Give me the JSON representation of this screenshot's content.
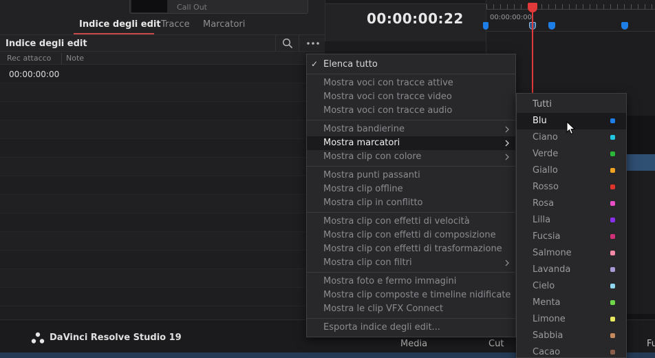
{
  "clip_card": {
    "name": "Call Out"
  },
  "panel": {
    "tabs": [
      {
        "label": "Indice degli edit",
        "active": true
      },
      {
        "label": "Tracce",
        "active": false
      },
      {
        "label": "Marcatori",
        "active": false
      }
    ],
    "title": "Indice degli edit",
    "columns": [
      "Rec attacco",
      "Note"
    ],
    "rows": [
      {
        "rec": "00:00:00:00",
        "note": ""
      }
    ]
  },
  "viewer": {
    "timecode": "00:00:00:22"
  },
  "timeline": {
    "ruler_timecode": "00:00:00:00"
  },
  "footer": {
    "app_name": "DaVinci Resolve Studio 19",
    "pages": [
      "Media",
      "Cut",
      "Fu"
    ]
  },
  "menu": {
    "groups": [
      [
        {
          "label": "Elenca tutto",
          "checked": true,
          "enabled": true
        }
      ],
      [
        {
          "label": "Mostra voci con tracce attive"
        },
        {
          "label": "Mostra voci con tracce video"
        },
        {
          "label": "Mostra voci con tracce audio"
        }
      ],
      [
        {
          "label": "Mostra bandierine",
          "submenu": true
        },
        {
          "label": "Mostra marcatori",
          "submenu": true,
          "highlighted": true
        },
        {
          "label": "Mostra clip con colore",
          "submenu": true
        }
      ],
      [
        {
          "label": "Mostra punti passanti"
        },
        {
          "label": "Mostra clip offline"
        },
        {
          "label": "Mostra clip in conflitto"
        }
      ],
      [
        {
          "label": "Mostra clip con effetti di velocità"
        },
        {
          "label": "Mostra clip con effetti di composizione"
        },
        {
          "label": "Mostra clip con effetti di trasformazione"
        },
        {
          "label": "Mostra clip con filtri",
          "submenu": true
        }
      ],
      [
        {
          "label": "Mostra foto e fermo immagini"
        },
        {
          "label": "Mostra clip composte e timeline nidificate"
        },
        {
          "label": "Mostra le clip VFX Connect"
        }
      ],
      [
        {
          "label": "Esporta indice degli edit..."
        }
      ]
    ]
  },
  "submenu": {
    "items": [
      {
        "label": "Tutti",
        "color": ""
      },
      {
        "label": "Blu",
        "color": "#1e7ee8",
        "highlighted": true
      },
      {
        "label": "Ciano",
        "color": "#21c7e0"
      },
      {
        "label": "Verde",
        "color": "#2bb83a"
      },
      {
        "label": "Giallo",
        "color": "#f0a323"
      },
      {
        "label": "Rosso",
        "color": "#e0342b"
      },
      {
        "label": "Rosa",
        "color": "#e84fc6"
      },
      {
        "label": "Lilla",
        "color": "#8a2ee8"
      },
      {
        "label": "Fucsia",
        "color": "#d0307a"
      },
      {
        "label": "Salmone",
        "color": "#f58aa6"
      },
      {
        "label": "Lavanda",
        "color": "#a79ad6"
      },
      {
        "label": "Cielo",
        "color": "#8fd6f0"
      },
      {
        "label": "Menta",
        "color": "#6fd64a"
      },
      {
        "label": "Limone",
        "color": "#e8e860"
      },
      {
        "label": "Sabbia",
        "color": "#c48a5e"
      },
      {
        "label": "Cacao",
        "color": "#8a5e4a"
      }
    ]
  }
}
